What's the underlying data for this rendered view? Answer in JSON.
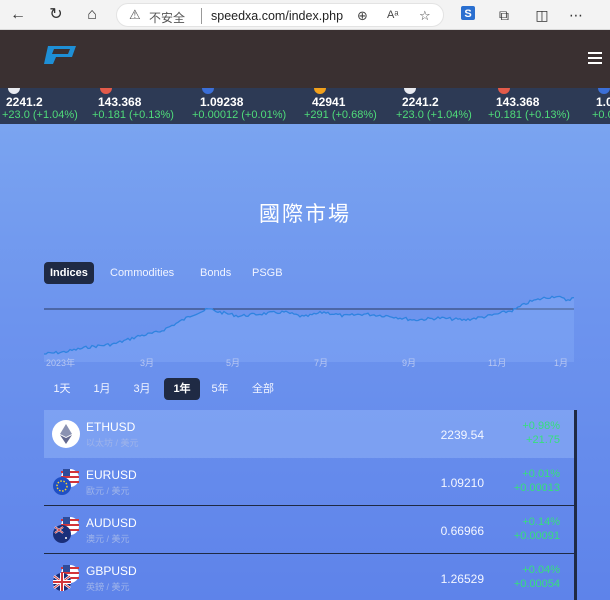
{
  "browser": {
    "insecure_label": "不安全",
    "url": "speedxa.com/index.php"
  },
  "ticker": [
    {
      "price": "2241.2",
      "change": "+23.0 (+1.04%)",
      "color": "#e8eaf0"
    },
    {
      "price": "143.368",
      "change": "+0.181 (+0.13%)",
      "color": "#e35b4a"
    },
    {
      "price": "1.09238",
      "change": "+0.00012 (+0.01%)",
      "color": "#3b6fd8"
    },
    {
      "price": "42941",
      "change": "+291 (+0.68%)",
      "color": "#f2a11b"
    },
    {
      "price": "2241.2",
      "change": "+23.0 (+1.04%)",
      "color": "#e8eaf0"
    },
    {
      "price": "143.368",
      "change": "+0.181 (+0.13%)",
      "color": "#e35b4a"
    },
    {
      "price": "1.0",
      "change": "+0.0",
      "color": "#3b6fd8"
    }
  ],
  "page_title": "國際市場",
  "category_tabs": [
    "Indices",
    "Commodities",
    "Bonds",
    "PSGB"
  ],
  "active_category": "Indices",
  "chart_data": {
    "type": "line",
    "x_tick_labels": [
      "2023年",
      "3月",
      "5月",
      "7月",
      "9月",
      "11月",
      "1月"
    ],
    "reference_line": true
  },
  "range_buttons": [
    "1天",
    "1月",
    "3月",
    "1年",
    "5年",
    "全部"
  ],
  "active_range": "1年",
  "markets": [
    {
      "symbol": "ETHUSD",
      "desc": "以太坊 / 美元",
      "price": "2239.54",
      "pct": "+0.98%",
      "abs": "+21.75",
      "icon": "ethereum-icon"
    },
    {
      "symbol": "EURUSD",
      "desc": "歐元 / 美元",
      "price": "1.09210",
      "pct": "+0.01%",
      "abs": "+0.00013",
      "icon": "eu-us-flag-icon"
    },
    {
      "symbol": "AUDUSD",
      "desc": "澳元 / 美元",
      "price": "0.66966",
      "pct": "+0.14%",
      "abs": "+0.00091",
      "icon": "au-us-flag-icon"
    },
    {
      "symbol": "GBPUSD",
      "desc": "英鎊 / 美元",
      "price": "1.26529",
      "pct": "+0.04%",
      "abs": "+0.00054",
      "icon": "uk-us-flag-icon"
    }
  ],
  "colors": {
    "accent_positive": "#35e07c",
    "header_bg": "#3a3031",
    "ticker_bg": "#2d3a55",
    "dark_chip": "#1f2a44"
  }
}
